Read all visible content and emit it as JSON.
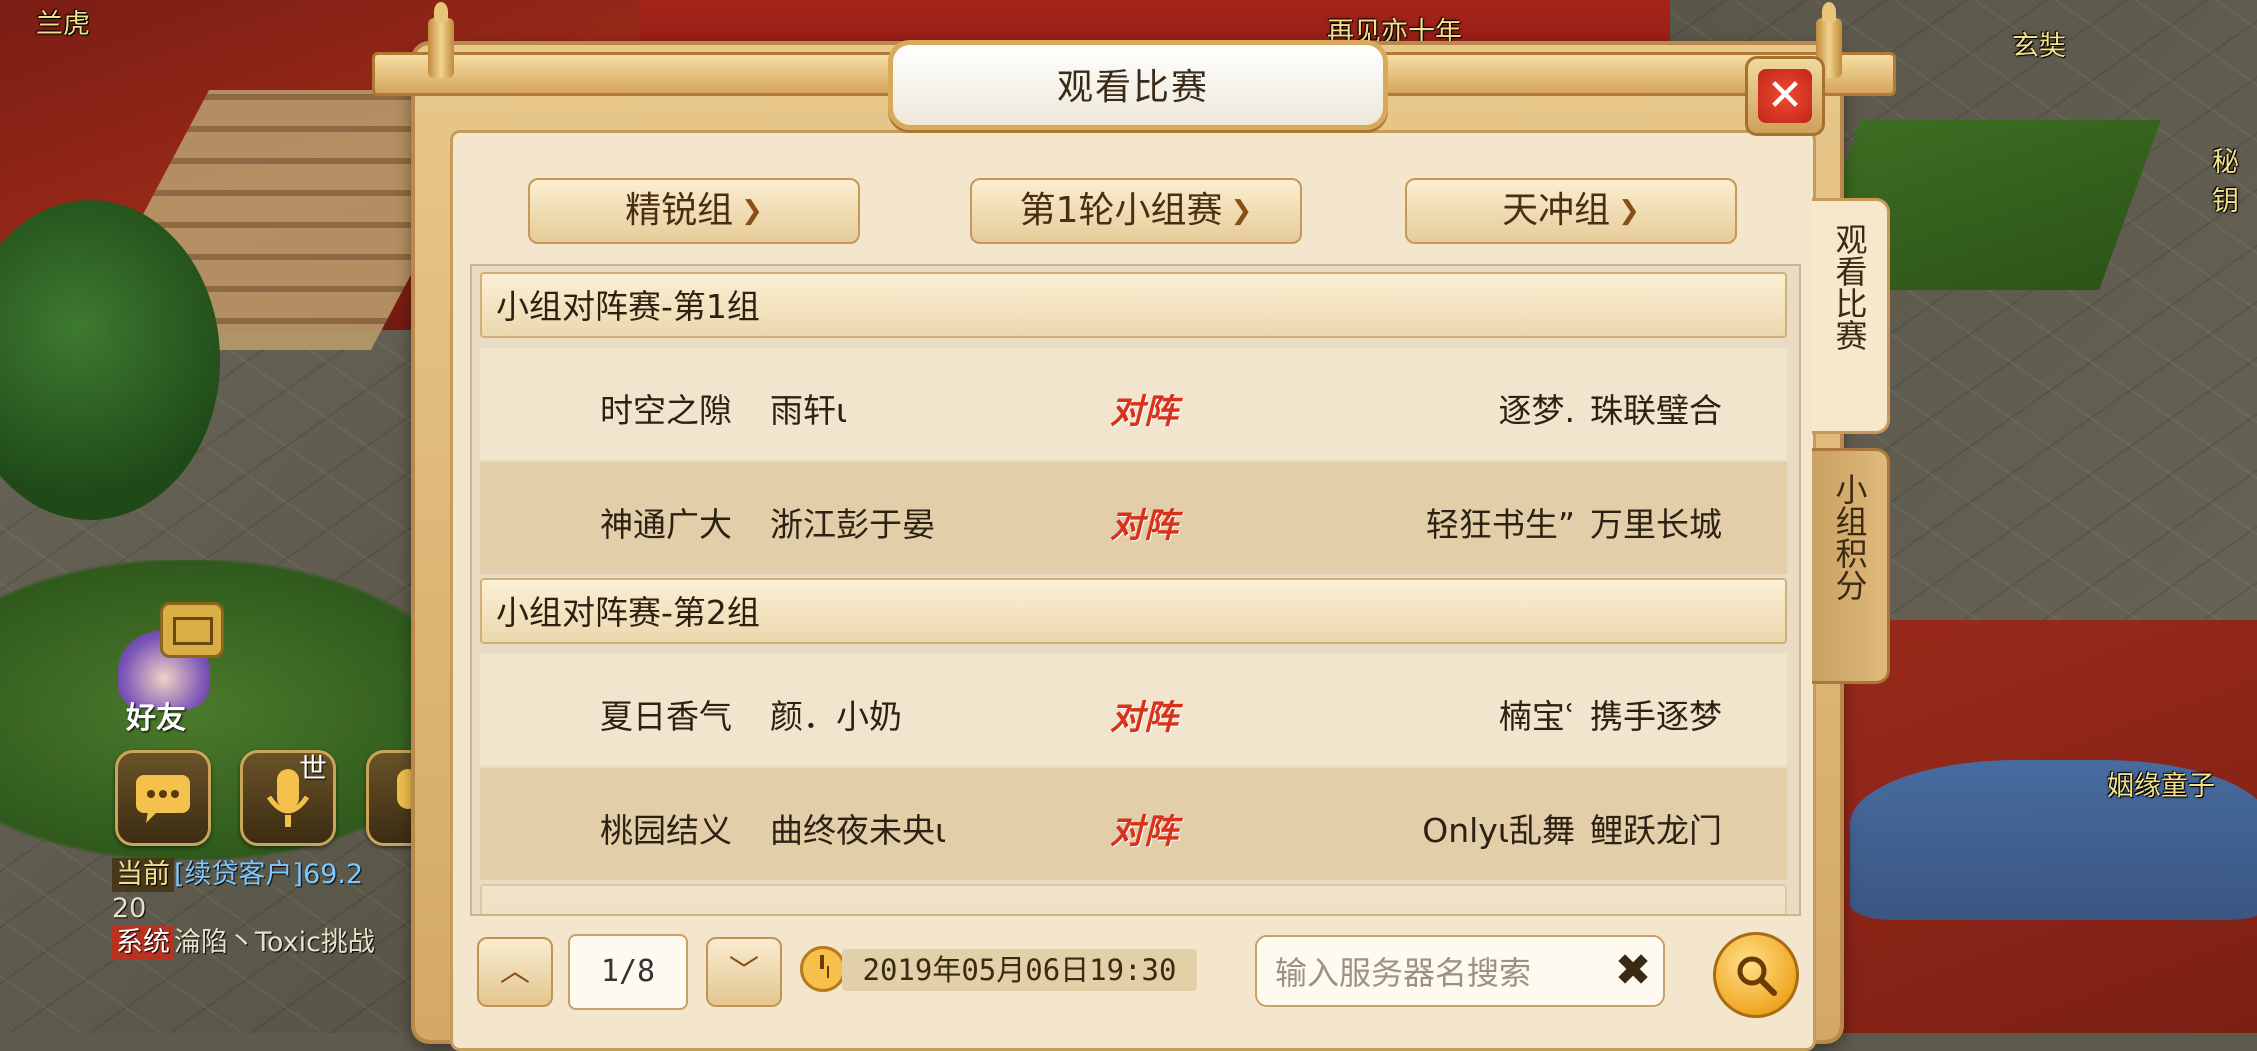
{
  "map_labels": {
    "top_left": "兰虎",
    "top_center": "再见亦十年",
    "top_right": "玄奘",
    "right_mid": "秘钥",
    "right_lower": "姻缘童子"
  },
  "hud": {
    "friend_label": "好友",
    "voice_world_badge": "世",
    "chat": [
      {
        "tag": "当前",
        "text": "[续贷客户]69.2",
        "cont": "20"
      },
      {
        "tag": "系统",
        "text": "淪陷丶Toxic挑战"
      }
    ]
  },
  "dialog": {
    "title": "观看比赛",
    "close_icon": "close-icon",
    "filters": {
      "division": "精锐组",
      "round": "第1轮小组赛",
      "group": "天冲组"
    },
    "side_tabs": [
      {
        "label": "观看比赛",
        "active": true
      },
      {
        "label": "小组积分",
        "active": false
      }
    ],
    "vs_label": "对阵",
    "groups": [
      {
        "title": "小组对阵赛-第1组",
        "matches": [
          {
            "left_server": "时空之隙",
            "left_player": "雨轩ι",
            "right_player": "逐梦.",
            "right_server": "珠联璧合"
          },
          {
            "left_server": "神通广大",
            "left_player": "浙江彭于晏",
            "right_player": "轻狂书生”",
            "right_server": "万里长城"
          }
        ]
      },
      {
        "title": "小组对阵赛-第2组",
        "matches": [
          {
            "left_server": "夏日香气",
            "left_player": "颜．小奶",
            "right_player": "楠宝ʿ",
            "right_server": "携手逐梦"
          },
          {
            "left_server": "桃园结义",
            "left_player": "曲终夜未央ι",
            "right_player": "Onlyι乱舞",
            "right_server": "鲤跃龙门"
          }
        ]
      }
    ],
    "pagination": {
      "current": "1/8"
    },
    "datetime": "2019年05月06日19:30",
    "search": {
      "placeholder": "输入服务器名搜索"
    }
  },
  "colors": {
    "accent_red": "#d8321b",
    "frame_gold": "#d4a865",
    "panel_bg": "#f3e6cc"
  }
}
